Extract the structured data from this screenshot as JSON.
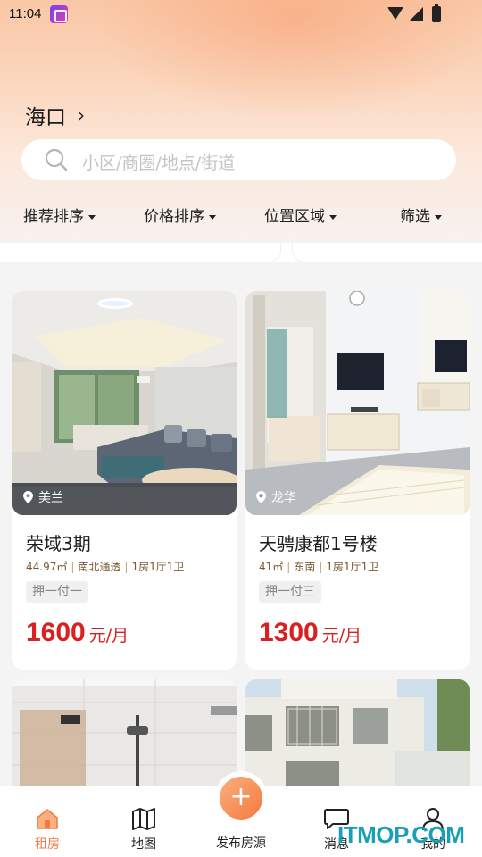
{
  "status_bar": {
    "time": "11:04"
  },
  "header": {
    "city": "海口",
    "search_placeholder": "小区/商圈/地点/街道"
  },
  "filters": [
    {
      "label": "推荐排序"
    },
    {
      "label": "价格排序"
    },
    {
      "label": "位置区域"
    },
    {
      "label": "筛选"
    }
  ],
  "listings": [
    {
      "location": "美兰",
      "title": "荣域3期",
      "area": "44.97㎡",
      "orientation": "南北通透",
      "layout": "1房1厅1卫",
      "deposit": "押一付一",
      "price": "1600",
      "price_unit": "元/月"
    },
    {
      "location": "龙华",
      "title": "天骋康都1号楼",
      "area": "41㎡",
      "orientation": "东南",
      "layout": "1房1厅1卫",
      "deposit": "押一付三",
      "price": "1300",
      "price_unit": "元/月"
    }
  ],
  "bottom_nav": {
    "items": [
      {
        "label": "租房",
        "icon": "house-icon",
        "active": true
      },
      {
        "label": "地图",
        "icon": "map-icon"
      },
      {
        "label": "消息",
        "icon": "message-icon"
      },
      {
        "label": "我的",
        "icon": "user-icon"
      }
    ],
    "publish_label": "发布房源",
    "publish_icon": "plus-icon"
  },
  "watermark": "ITMOP.COM",
  "colors": {
    "accent": "#f07a45",
    "price": "#d92121",
    "meta": "#7a5a32"
  }
}
